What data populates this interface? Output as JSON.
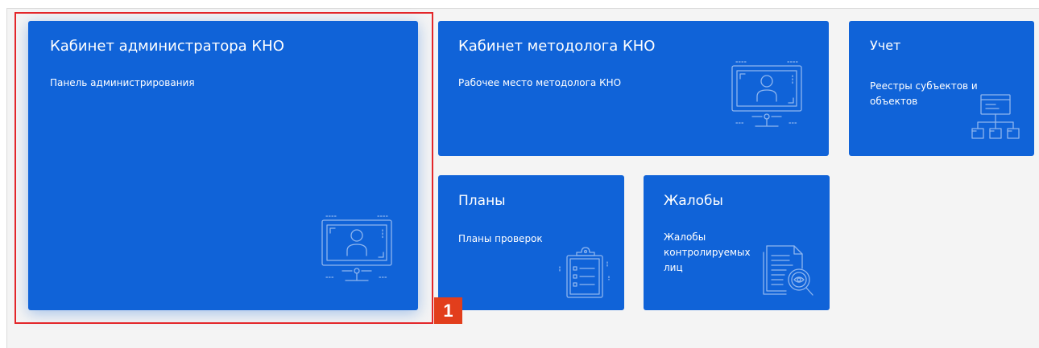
{
  "tiles": {
    "admin": {
      "title": "Кабинет администратора КНО",
      "subtitle": "Панель администрирования",
      "icon": "monitor-user-icon"
    },
    "methodologist": {
      "title": "Кабинет методолога КНО",
      "subtitle": "Рабочее место методолога КНО",
      "icon": "monitor-user-icon"
    },
    "accounting": {
      "title": "Учет",
      "subtitle": "Реестры субъектов и объектов",
      "icon": "hierarchy-registry-icon"
    },
    "plans": {
      "title": "Планы",
      "subtitle": "Планы проверок",
      "icon": "clipboard-checklist-icon"
    },
    "complaints": {
      "title": "Жалобы",
      "subtitle": "Жалобы контролируемых лиц",
      "icon": "document-search-icon"
    }
  },
  "annotation": {
    "label": "1",
    "color": "#e23e1c",
    "frame_color": "#e3262a"
  },
  "colors": {
    "tile": "#1063d8",
    "background": "#f4f4f4",
    "icon_stroke": "#8fb6ef"
  }
}
